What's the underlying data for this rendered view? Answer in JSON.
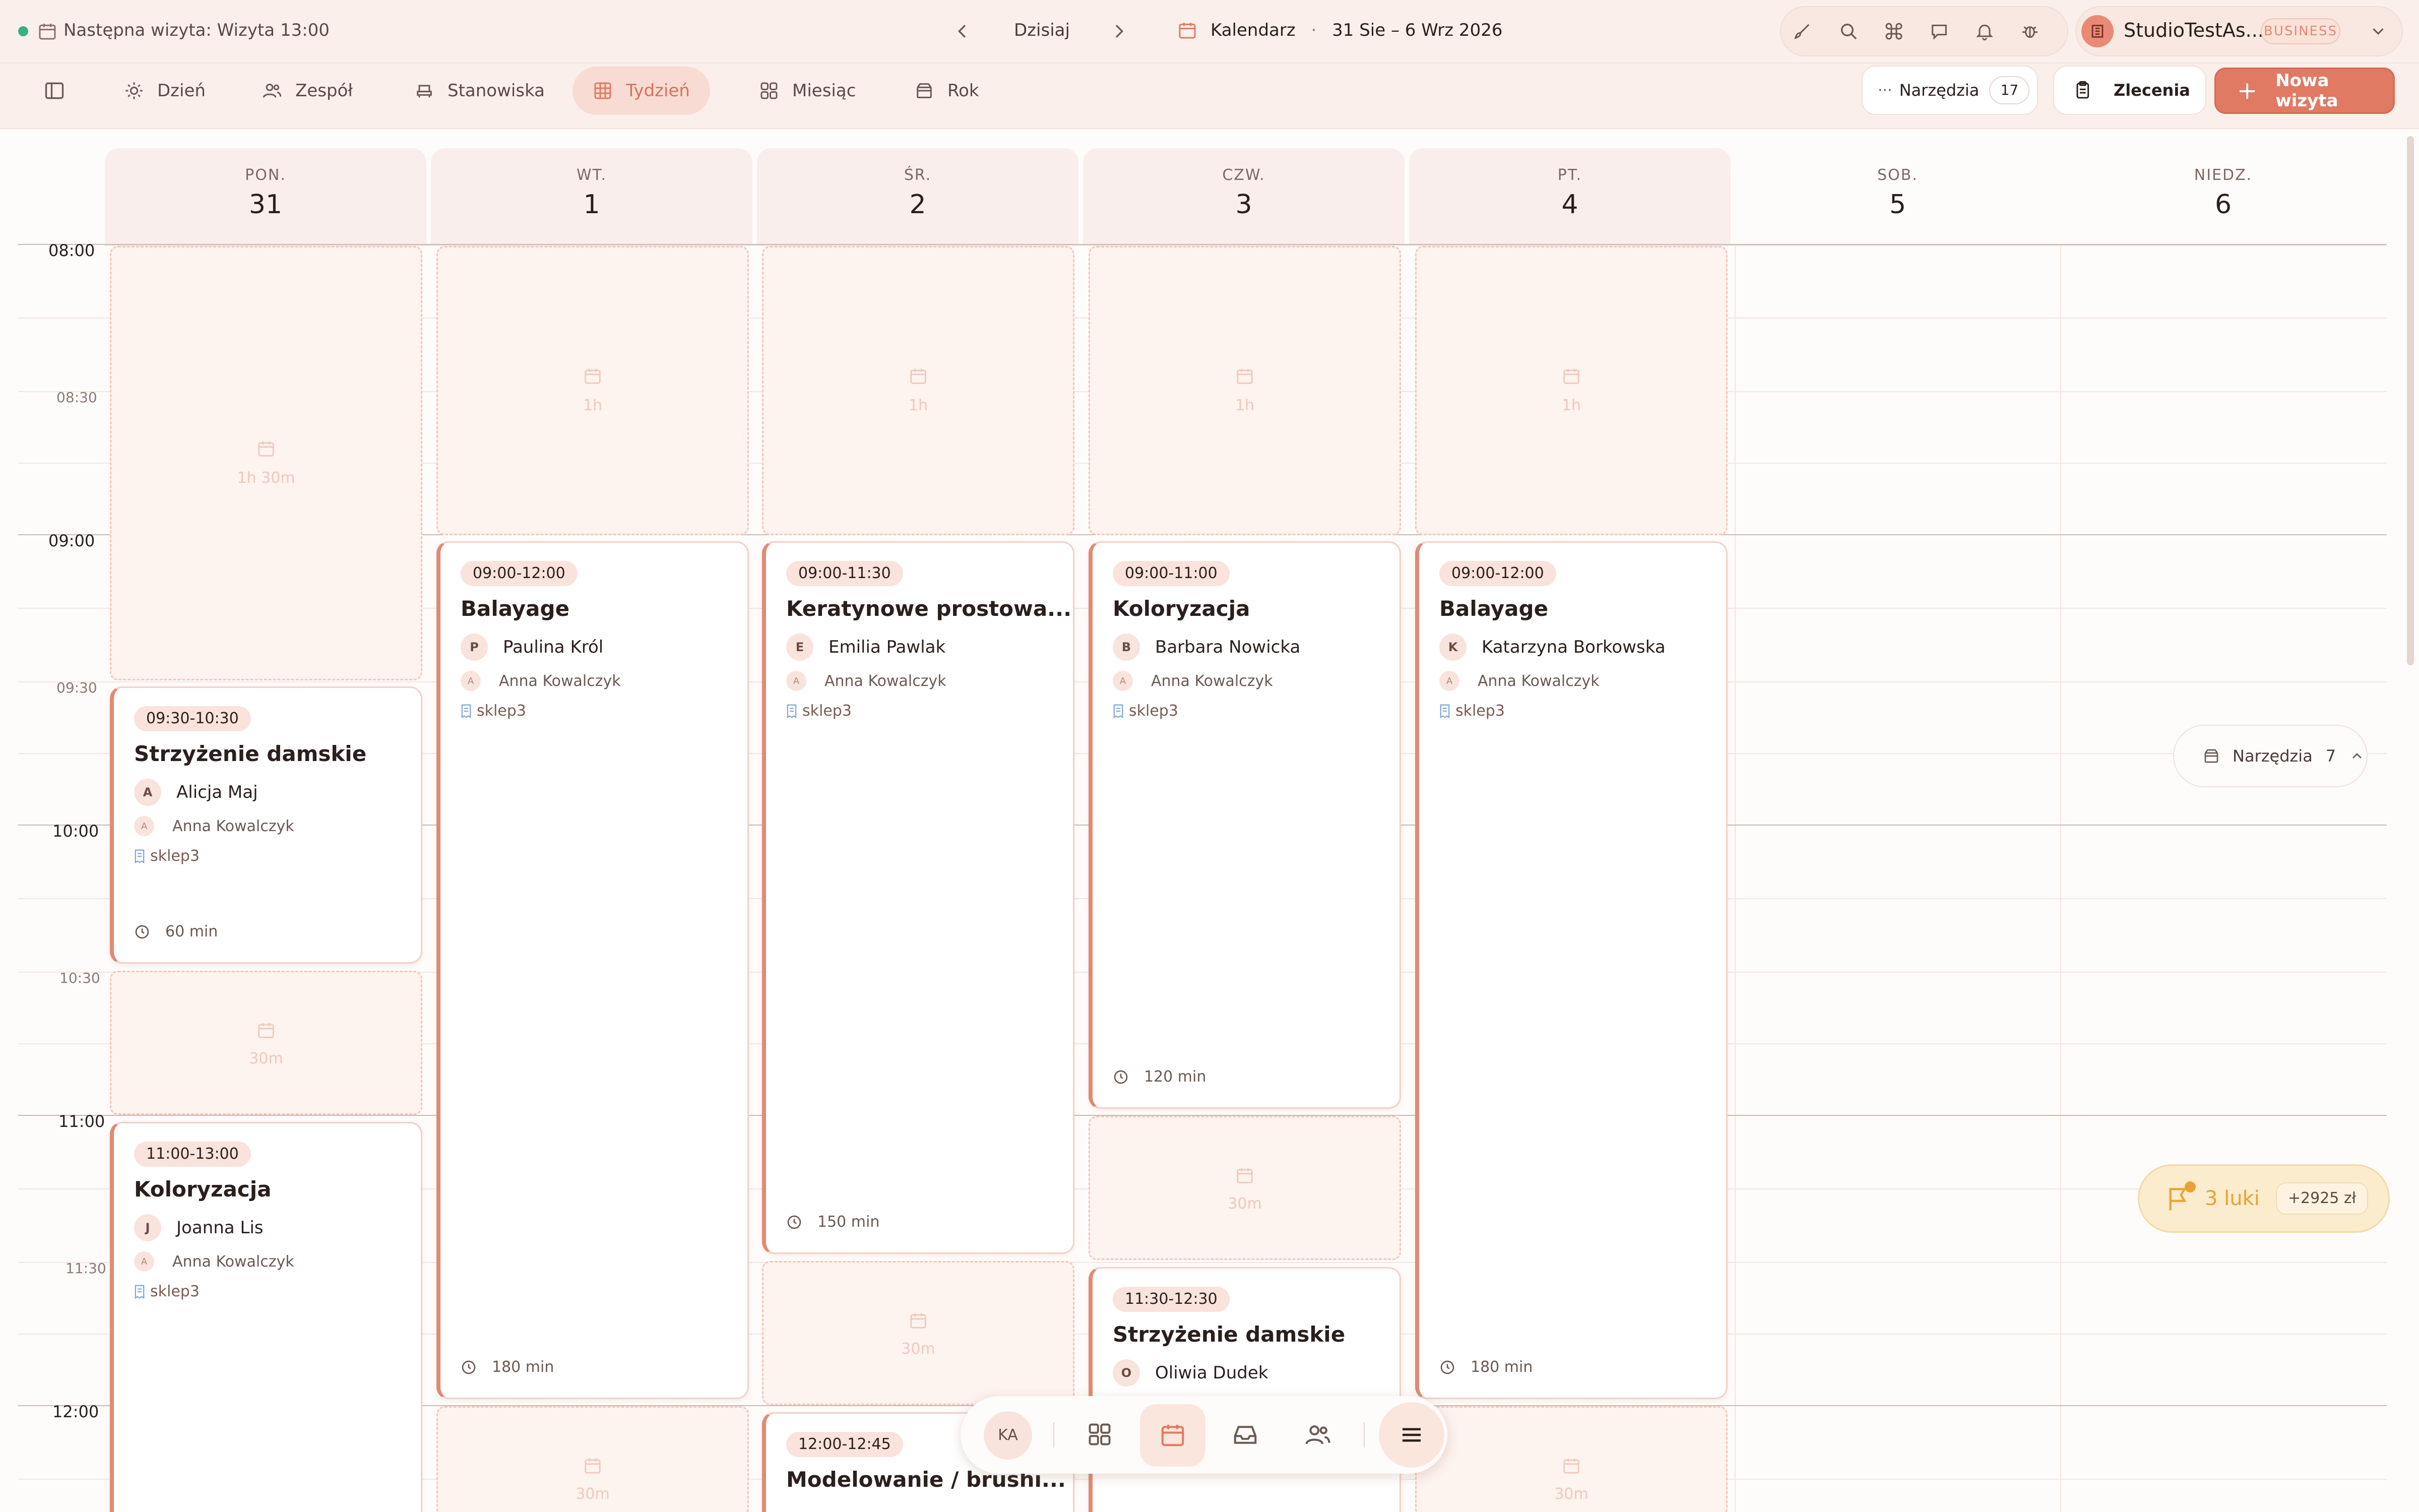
{
  "topbar": {
    "next_visit_label": "Następna wizyta: Wizyta",
    "next_visit_time": "13:00",
    "today_label": "Dzisiaj",
    "calendar_label": "Kalendarz",
    "separator": "·",
    "date_range": "31 Sie – 6 Wrz 2026",
    "studio_name": "StudioTestAs...",
    "plan_badge": "BUSINESS"
  },
  "nav": {
    "tabs": [
      {
        "label": "Dzień",
        "icon": "sun-icon"
      },
      {
        "label": "Zespół",
        "icon": "team-icon"
      },
      {
        "label": "Stanowiska",
        "icon": "chair-icon"
      },
      {
        "label": "Tydzień",
        "icon": "grid-icon"
      },
      {
        "label": "Miesiąc",
        "icon": "squares-icon"
      },
      {
        "label": "Rok",
        "icon": "box-icon"
      }
    ],
    "tools_label": "Narzędzia",
    "tools_count": "17",
    "orders_label": "Zlecenia",
    "new_visit_label": "Nowa wizyta"
  },
  "days": [
    {
      "name": "PON.",
      "num": "31"
    },
    {
      "name": "WT.",
      "num": "1"
    },
    {
      "name": "ŚR.",
      "num": "2"
    },
    {
      "name": "CZW.",
      "num": "3"
    },
    {
      "name": "PT.",
      "num": "4"
    },
    {
      "name": "SOB.",
      "num": "5"
    },
    {
      "name": "NIEDZ.",
      "num": "6"
    }
  ],
  "times": {
    "t0800": "08:00",
    "t0830": "08:30",
    "t0900": "09:00",
    "t0930": "09:30",
    "t1000": "10:00",
    "t1030": "10:30",
    "t1100": "11:00",
    "t1130": "11:30",
    "t1200": "12:00"
  },
  "free_slots": {
    "mon_1": "1h 30m",
    "mon_2": "30m",
    "tue_1": "1h",
    "tue_2": "30m",
    "wed_1": "1h",
    "wed_2": "30m",
    "thu_1": "1h",
    "thu_2": "30m",
    "fri_1": "1h",
    "fri_2": "30m"
  },
  "appointments": [
    {
      "time": "09:30-10:30",
      "service": "Strzyżenie damskie",
      "client_initial": "A",
      "client": "Alicja Maj",
      "staff_initial": "A",
      "staff": "Anna Kowalczyk",
      "location": "sklep3",
      "duration": "60 min"
    },
    {
      "time": "11:00-13:00",
      "service": "Koloryzacja",
      "client_initial": "J",
      "client": "Joanna Lis",
      "staff_initial": "A",
      "staff": "Anna Kowalczyk",
      "location": "sklep3"
    },
    {
      "time": "09:00-12:00",
      "service": "Balayage",
      "client_initial": "P",
      "client": "Paulina Król",
      "staff_initial": "A",
      "staff": "Anna Kowalczyk",
      "location": "sklep3",
      "duration": "180 min"
    },
    {
      "time": "09:00-11:30",
      "service": "Keratynowe prostowa...",
      "client_initial": "E",
      "client": "Emilia Pawlak",
      "staff_initial": "A",
      "staff": "Anna Kowalczyk",
      "location": "sklep3",
      "duration": "150 min"
    },
    {
      "time": "12:00-12:45",
      "service": "Modelowanie / brushi..."
    },
    {
      "time": "09:00-11:00",
      "service": "Koloryzacja",
      "client_initial": "B",
      "client": "Barbara Nowicka",
      "staff_initial": "A",
      "staff": "Anna Kowalczyk",
      "location": "sklep3",
      "duration": "120 min"
    },
    {
      "time": "11:30-12:30",
      "service": "Strzyżenie damskie",
      "client_initial": "O",
      "client": "Oliwia Dudek"
    },
    {
      "time": "09:00-12:00",
      "service": "Balayage",
      "client_initial": "K",
      "client": "Katarzyna Borkowska",
      "staff_initial": "A",
      "staff": "Anna Kowalczyk",
      "location": "sklep3",
      "duration": "180 min"
    }
  ],
  "side_tools": {
    "label": "Narzędzia",
    "count": "7"
  },
  "gaps": {
    "label": "3 luki",
    "amount": "+2925 zł"
  },
  "dock": {
    "avatar": "KA"
  },
  "colors": {
    "accent": "#e07a62",
    "accent_bg": "#f8dcd3",
    "topbar_bg": "#fbefeb",
    "gaps_bg": "#fbeccd"
  }
}
